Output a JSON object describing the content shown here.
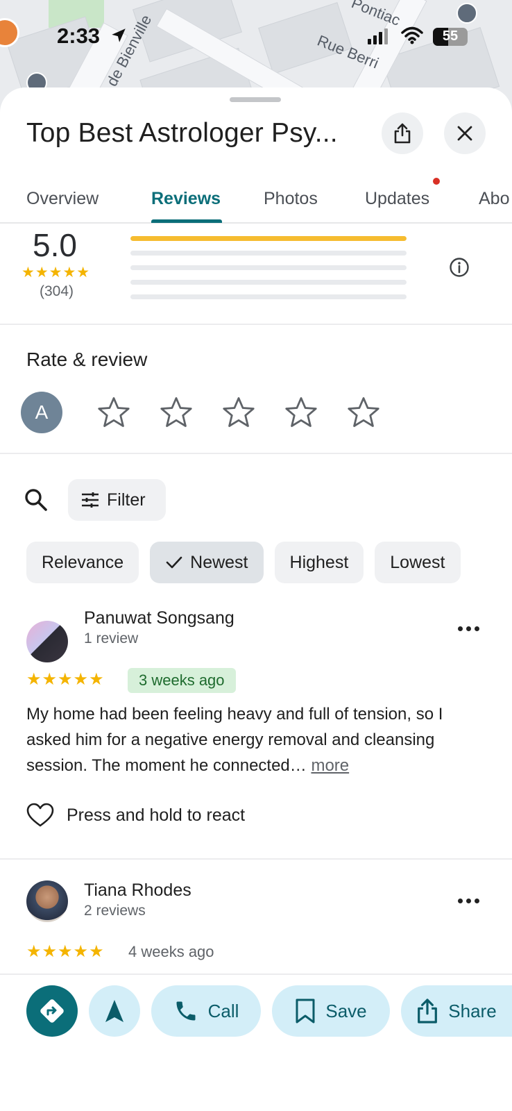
{
  "status_bar": {
    "time": "2:33",
    "battery": "55"
  },
  "map": {
    "labels": [
      "de Bienville",
      "Rue Berri",
      "Pontiac"
    ]
  },
  "place": {
    "title": "Top Best Astrologer Psy..."
  },
  "tabs": [
    {
      "label": "Overview"
    },
    {
      "label": "Reviews",
      "active": true
    },
    {
      "label": "Photos"
    },
    {
      "label": "Updates",
      "has_notification": true
    },
    {
      "label": "Abo"
    }
  ],
  "rating_summary": {
    "average": "5.0",
    "stars": "★★★★★",
    "count": "(304)",
    "distribution": [
      {
        "stars": 5,
        "fraction": 1.0
      },
      {
        "stars": 4,
        "fraction": 0.0
      },
      {
        "stars": 3,
        "fraction": 0.0
      },
      {
        "stars": 2,
        "fraction": 0.0
      },
      {
        "stars": 1,
        "fraction": 0.0
      }
    ]
  },
  "rate_review": {
    "title": "Rate & review",
    "avatar_initial": "A"
  },
  "filter": {
    "label": "Filter"
  },
  "sort_chips": [
    {
      "label": "Relevance",
      "selected": false
    },
    {
      "label": "Newest",
      "selected": true
    },
    {
      "label": "Highest",
      "selected": false
    },
    {
      "label": "Lowest",
      "selected": false
    }
  ],
  "reviews": [
    {
      "name": "Panuwat Songsang",
      "review_count": "1 review",
      "stars": "★★★★★",
      "date": "3 weeks ago",
      "text": "My home had been feeling heavy and full of tension, so I asked him for a negative energy removal and cleansing session. The moment he connected… ",
      "more": "more",
      "react_label": "Press and hold to react"
    },
    {
      "name": "Tiana Rhodes",
      "review_count": "2 reviews",
      "stars": "★★★★★",
      "date": "4 weeks ago"
    }
  ],
  "actions": [
    {
      "label": ""
    },
    {
      "label": ""
    },
    {
      "label": "Call"
    },
    {
      "label": "Save"
    },
    {
      "label": "Share"
    }
  ],
  "colors": {
    "accent": "#0b6e79",
    "star": "#f4b400",
    "action_bg": "#d3eef8"
  }
}
